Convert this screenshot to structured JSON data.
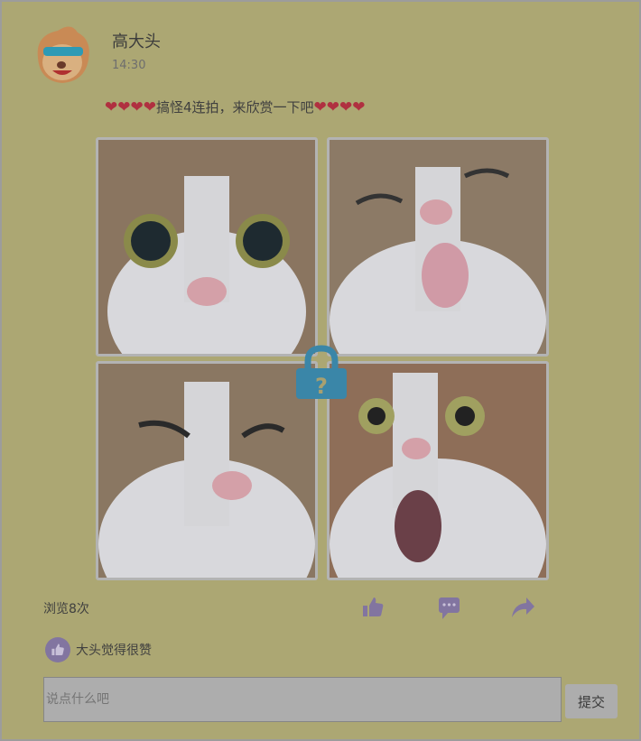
{
  "post": {
    "author": "高大头",
    "time": "14:30",
    "text_prefix_hearts": "❤❤❤❤",
    "text": "搞怪4连拍，来欣赏一下吧",
    "text_suffix_hearts": "❤❤❤❤",
    "images": [
      "cat-wide-eyes",
      "cat-tongue-out",
      "cat-squint",
      "cat-open-mouth"
    ]
  },
  "stats": {
    "views": "浏览8次",
    "liked_by": "大头觉得很赞"
  },
  "actions": {
    "like": "like-icon",
    "comment": "comment-icon",
    "share": "share-icon"
  },
  "comment": {
    "placeholder": "说点什么吧",
    "submit_label": "提交"
  },
  "colors": {
    "background": "#aca773",
    "icon": "#8275a0",
    "lock": "#3a86a8"
  }
}
